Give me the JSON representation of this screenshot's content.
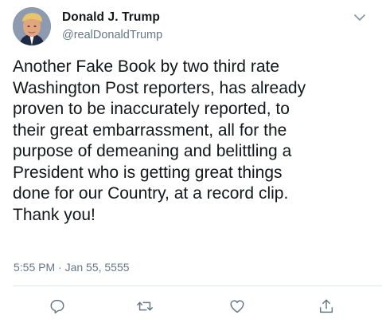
{
  "author": {
    "display_name": "Donald J. Trump",
    "handle": "@realDonaldTrump"
  },
  "tweet": {
    "text": "Another Fake Book by two third rate\nWashington Post reporters, has already\nproven to be inaccurately reported, to\ntheir great embarrassment, all for the\npurpose of demeaning and belittling a\nPresident who is getting great things\ndone for our Country, at a record clip.\nThank you!",
    "timestamp": "5:55 PM · Jan 55, 5555"
  },
  "icons": {
    "menu": "chevron-down-icon",
    "reply": "reply-icon",
    "retweet": "retweet-icon",
    "like": "heart-icon",
    "share": "share-icon"
  },
  "colors": {
    "text": "#14171a",
    "secondary": "#657786",
    "divider": "#e1e8ed"
  }
}
